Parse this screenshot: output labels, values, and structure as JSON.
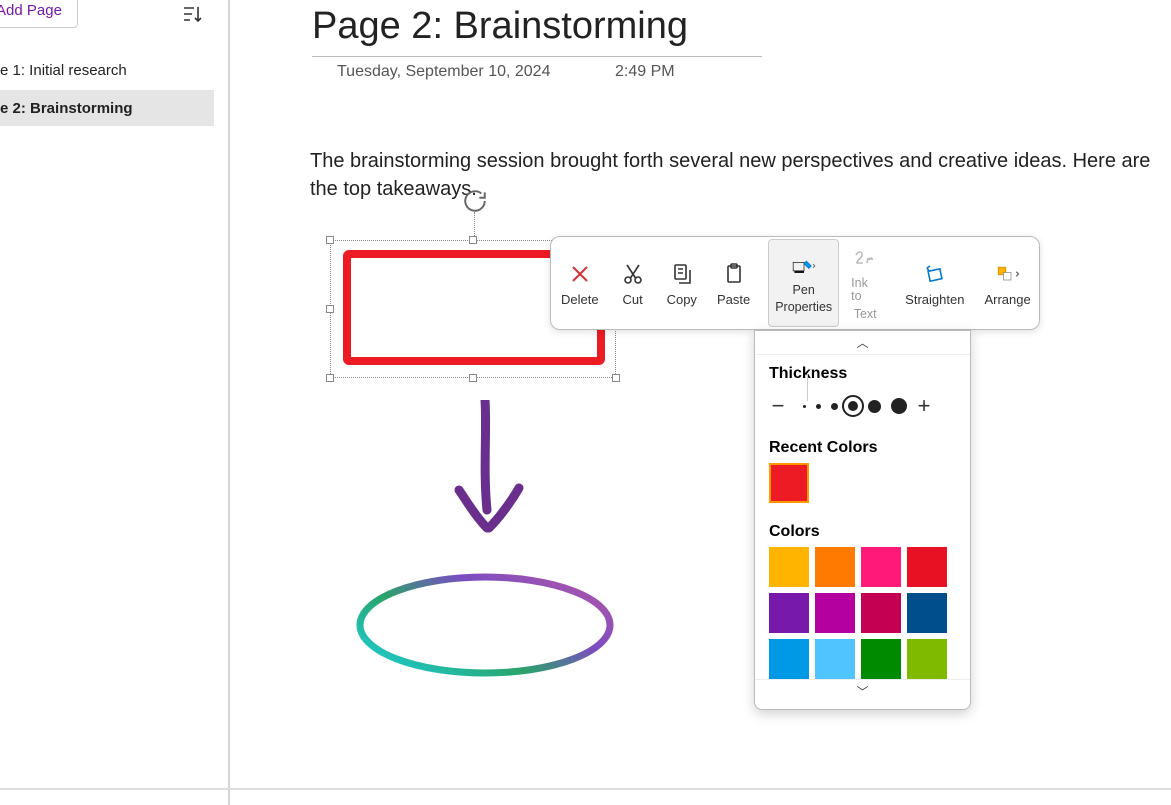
{
  "sidebar": {
    "addPageLabel": "Add Page",
    "items": [
      {
        "label": "e 1: Initial research"
      },
      {
        "label": "e 2: Brainstorming"
      }
    ]
  },
  "page": {
    "title": "Page 2: Brainstorming",
    "date": "Tuesday, September 10, 2024",
    "time": "2:49 PM",
    "body": "The brainstorming session brought forth several new perspectives and creative ideas. Here are the top takeaways."
  },
  "toolbar": {
    "delete": "Delete",
    "cut": "Cut",
    "copy": "Copy",
    "paste": "Paste",
    "penProperties": "Pen Properties",
    "penPropertiesLine1": "Pen",
    "penPropertiesLine2": "Properties",
    "inkToText": "Ink to Text",
    "inkToLine1": "Ink to",
    "inkToLine2": "Text",
    "straighten": "Straighten",
    "arrange": "Arrange"
  },
  "penPanel": {
    "thicknessLabel": "Thickness",
    "recentColorsLabel": "Recent Colors",
    "colorsLabel": "Colors",
    "thicknessOptions": [
      3,
      5,
      7,
      10,
      13,
      16
    ],
    "selectedThicknessIndex": 3,
    "recentColors": [
      "#ed1c24"
    ],
    "selectedRecentIndex": 0,
    "colorGrid": [
      "#ffb400",
      "#ff7a00",
      "#ff1978",
      "#e81123",
      "#7719aa",
      "#b4009e",
      "#c30052",
      "#004e8c",
      "#0099e5",
      "#4fc4ff",
      "#008a00",
      "#7fba00"
    ]
  }
}
